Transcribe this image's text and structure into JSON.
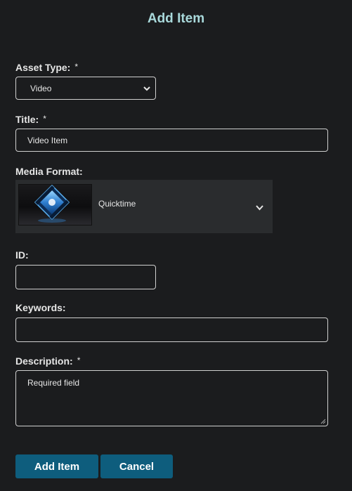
{
  "dialog": {
    "title": "Add Item"
  },
  "form": {
    "asset_type": {
      "label": "Asset Type:",
      "required_mark": "*",
      "value": "Video",
      "icon": "chevron-down-icon"
    },
    "title": {
      "label": "Title:",
      "required_mark": "*",
      "value": "Video Item"
    },
    "media_format": {
      "label": "Media Format:",
      "value": "Quicktime",
      "thumbnail_icon": "quicktime-film-icon",
      "icon": "chevron-down-icon"
    },
    "id": {
      "label": "ID:",
      "value": ""
    },
    "keywords": {
      "label": "Keywords:",
      "value": ""
    },
    "description": {
      "label": "Description:",
      "required_mark": "*",
      "placeholder": "Required field"
    }
  },
  "buttons": {
    "add_label": "Add Item",
    "cancel_label": "Cancel"
  },
  "colors": {
    "background": "#1b1c1e",
    "title": "#a9d9db",
    "button": "#0e5d7d",
    "media_panel": "#2a2c2e"
  }
}
